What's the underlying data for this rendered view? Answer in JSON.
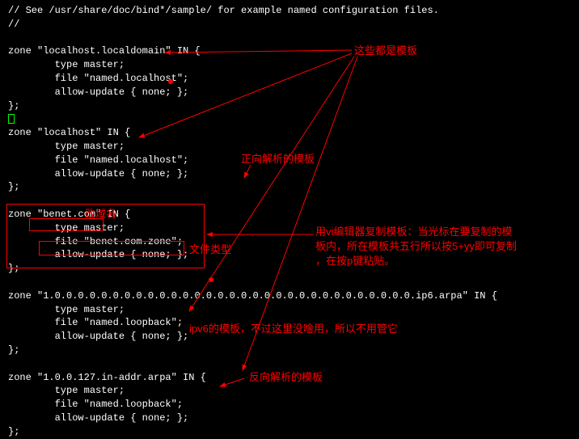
{
  "code": {
    "comment1": "// See /usr/share/doc/bind*/sample/ for example named configuration files.",
    "comment2": "//",
    "zone1_open": "zone \"localhost.localdomain\" IN {",
    "zone1_type": "        type master;",
    "zone1_file": "        file \"named.localhost\";",
    "zone1_allow": "        allow-update { none; };",
    "zone1_close": "};",
    "zone2_open": "zone \"localhost\" IN {",
    "zone2_type": "        type master;",
    "zone2_file": "        file \"named.localhost\";",
    "zone2_allow": "        allow-update { none; };",
    "zone2_close": "};",
    "zone3_open": "zone \"benet.com\" IN {",
    "zone3_type": "        type master;",
    "zone3_file": "        file \"benet.com.zone\";",
    "zone3_allow": "        allow-update { none; };",
    "zone3_close": "};",
    "zone4_open": "zone \"1.0.0.0.0.0.0.0.0.0.0.0.0.0.0.0.0.0.0.0.0.0.0.0.0.0.0.0.0.0.0.0.ip6.arpa\" IN {",
    "zone4_type": "        type master;",
    "zone4_file": "        file \"named.loopback\";",
    "zone4_allow": "        allow-update { none; };",
    "zone4_close": "};",
    "zone5_open": "zone \"1.0.0.127.in-addr.arpa\" IN {",
    "zone5_type": "        type master;",
    "zone5_file": "        file \"named.loopback\";",
    "zone5_allow": "        allow-update { none; };",
    "zone5_close": "};"
  },
  "annotations": {
    "header": "这些都是模板",
    "forward": "正向解析的模板",
    "domain_change": "改域名",
    "file_type": "文件类型",
    "vi_copy_line1": "用vi编辑器复制模板：当光标在要复制的模",
    "vi_copy_line2": "板内，所在模板共五行所以按5+yy即可复制",
    "vi_copy_line3": "，在按p键粘贴。",
    "ipv6": "ipv6的模板，不过这里没啥用，所以不用管它",
    "reverse": "反向解析的模板"
  }
}
